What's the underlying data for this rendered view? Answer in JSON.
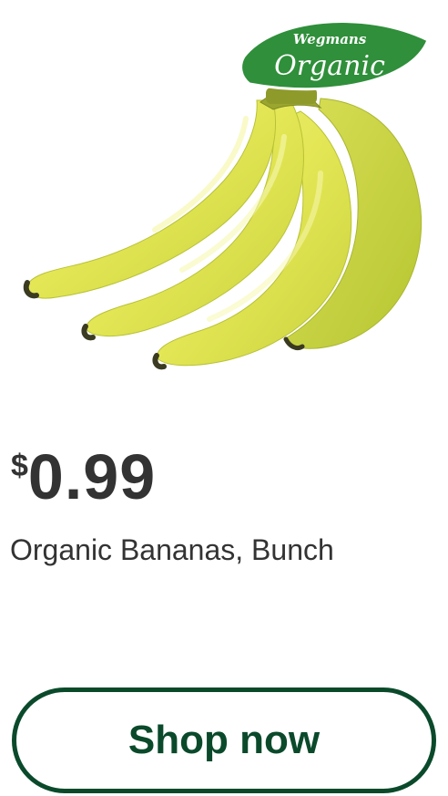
{
  "product": {
    "image_alt": "Organic Bananas",
    "badge": {
      "brand": "Wegmans",
      "label": "Organic",
      "color": "#2f8f3a"
    },
    "price": {
      "currency": "$",
      "amount": "0.99"
    },
    "name": "Organic Bananas, Bunch"
  },
  "actions": {
    "shop_label": "Shop now",
    "accent_color": "#0a4a2b"
  }
}
